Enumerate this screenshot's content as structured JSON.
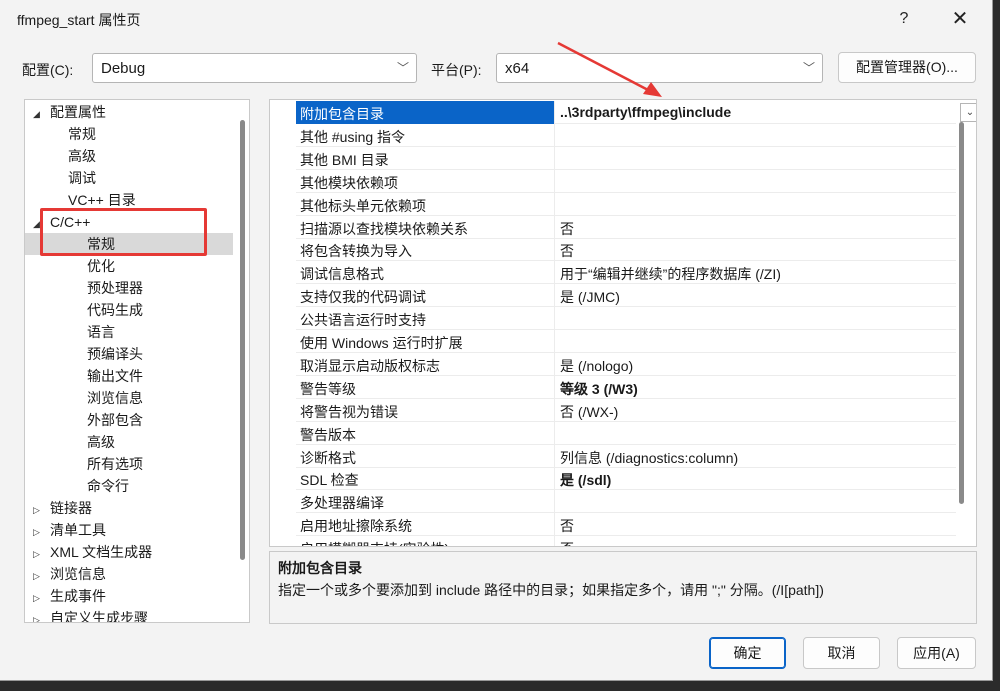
{
  "window": {
    "title": "ffmpeg_start 属性页",
    "help_glyph": "?",
    "close_glyph": "✕"
  },
  "config": {
    "config_label": "配置(C):",
    "config_value": "Debug",
    "platform_label": "平台(P):",
    "platform_value": "x64",
    "manager_button": "配置管理器(O)..."
  },
  "tree": {
    "items": [
      {
        "label": "配置属性",
        "expander": "◢"
      },
      {
        "label": "常规"
      },
      {
        "label": "高级"
      },
      {
        "label": "调试"
      },
      {
        "label": "VC++ 目录"
      },
      {
        "label": "C/C++",
        "expander": "◢"
      },
      {
        "label": "常规"
      },
      {
        "label": "优化"
      },
      {
        "label": "预处理器"
      },
      {
        "label": "代码生成"
      },
      {
        "label": "语言"
      },
      {
        "label": "预编译头"
      },
      {
        "label": "输出文件"
      },
      {
        "label": "浏览信息"
      },
      {
        "label": "外部包含"
      },
      {
        "label": "高级"
      },
      {
        "label": "所有选项"
      },
      {
        "label": "命令行"
      },
      {
        "label": "链接器",
        "expander": "▷"
      },
      {
        "label": "清单工具",
        "expander": "▷"
      },
      {
        "label": "XML 文档生成器",
        "expander": "▷"
      },
      {
        "label": "浏览信息",
        "expander": "▷"
      },
      {
        "label": "生成事件",
        "expander": "▷"
      },
      {
        "label": "自定义生成步骤",
        "expander": "▷"
      }
    ]
  },
  "grid": {
    "rows": [
      {
        "name": "附加包含目录",
        "value": "..\\3rdparty\\ffmpeg\\include",
        "bold": true
      },
      {
        "name": "其他 #using 指令",
        "value": ""
      },
      {
        "name": "其他 BMI 目录",
        "value": ""
      },
      {
        "name": "其他模块依赖项",
        "value": ""
      },
      {
        "name": "其他标头单元依赖项",
        "value": ""
      },
      {
        "name": "扫描源以查找模块依赖关系",
        "value": "否"
      },
      {
        "name": "将包含转换为导入",
        "value": "否"
      },
      {
        "name": "调试信息格式",
        "value": "用于“编辑并继续”的程序数据库 (/ZI)"
      },
      {
        "name": "支持仅我的代码调试",
        "value": "是 (/JMC)"
      },
      {
        "name": "公共语言运行时支持",
        "value": ""
      },
      {
        "name": "使用 Windows 运行时扩展",
        "value": ""
      },
      {
        "name": "取消显示启动版权标志",
        "value": "是 (/nologo)"
      },
      {
        "name": "警告等级",
        "value": "等级 3 (/W3)",
        "bold": true
      },
      {
        "name": "将警告视为错误",
        "value": "否 (/WX-)"
      },
      {
        "name": "警告版本",
        "value": ""
      },
      {
        "name": "诊断格式",
        "value": "列信息 (/diagnostics:column)"
      },
      {
        "name": "SDL 检查",
        "value": "是 (/sdl)",
        "bold": true
      },
      {
        "name": "多处理器编译",
        "value": ""
      },
      {
        "name": "启用地址擦除系统",
        "value": "否"
      },
      {
        "name": "启用模糊器支持(实验性)",
        "value": "否"
      }
    ],
    "dropdown_glyph": "⌄"
  },
  "description": {
    "title": "附加包含目录",
    "text": "指定一个或多个要添加到 include 路径中的目录；如果指定多个，请用 \";\" 分隔。(/I[path])"
  },
  "buttons": {
    "ok": "确定",
    "cancel": "取消",
    "apply": "应用(A)"
  },
  "annotation_color": "#e53935",
  "accent_color": "#0a64c8"
}
